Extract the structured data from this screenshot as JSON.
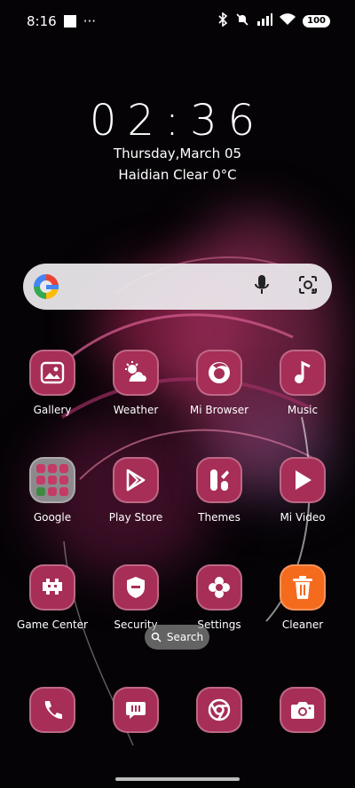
{
  "status_bar": {
    "time": "8:16",
    "overflow": "···",
    "battery": "100",
    "icons": [
      "bluetooth-icon",
      "silent-icon",
      "signal-icon",
      "wifi-icon",
      "battery-icon"
    ]
  },
  "widget": {
    "time": "02:36",
    "date": "Thursday,March 05",
    "weather": "Haidian Clear 0°C"
  },
  "search_widget": {
    "icons": [
      "google-g-icon",
      "microphone-icon",
      "lens-icon"
    ]
  },
  "apps": [
    {
      "label": "Gallery",
      "icon": "gallery-icon"
    },
    {
      "label": "Weather",
      "icon": "weather-icon"
    },
    {
      "label": "Mi Browser",
      "icon": "browser-icon"
    },
    {
      "label": "Music",
      "icon": "music-icon"
    },
    {
      "label": "Google",
      "icon": "folder-icon"
    },
    {
      "label": "Play Store",
      "icon": "play-store-icon"
    },
    {
      "label": "Themes",
      "icon": "themes-icon"
    },
    {
      "label": "Mi Video",
      "icon": "video-icon"
    },
    {
      "label": "Game Center",
      "icon": "game-icon"
    },
    {
      "label": "Security",
      "icon": "security-icon"
    },
    {
      "label": "Settings",
      "icon": "settings-icon"
    },
    {
      "label": "Cleaner",
      "icon": "cleaner-icon"
    }
  ],
  "search_pill": {
    "label": "Search"
  },
  "dock": [
    {
      "icon": "phone-icon"
    },
    {
      "icon": "messages-icon"
    },
    {
      "icon": "chrome-icon"
    },
    {
      "icon": "camera-icon"
    }
  ],
  "colors": {
    "icon_bg": "#a62e57",
    "cleaner_bg": "#f56b1d"
  }
}
